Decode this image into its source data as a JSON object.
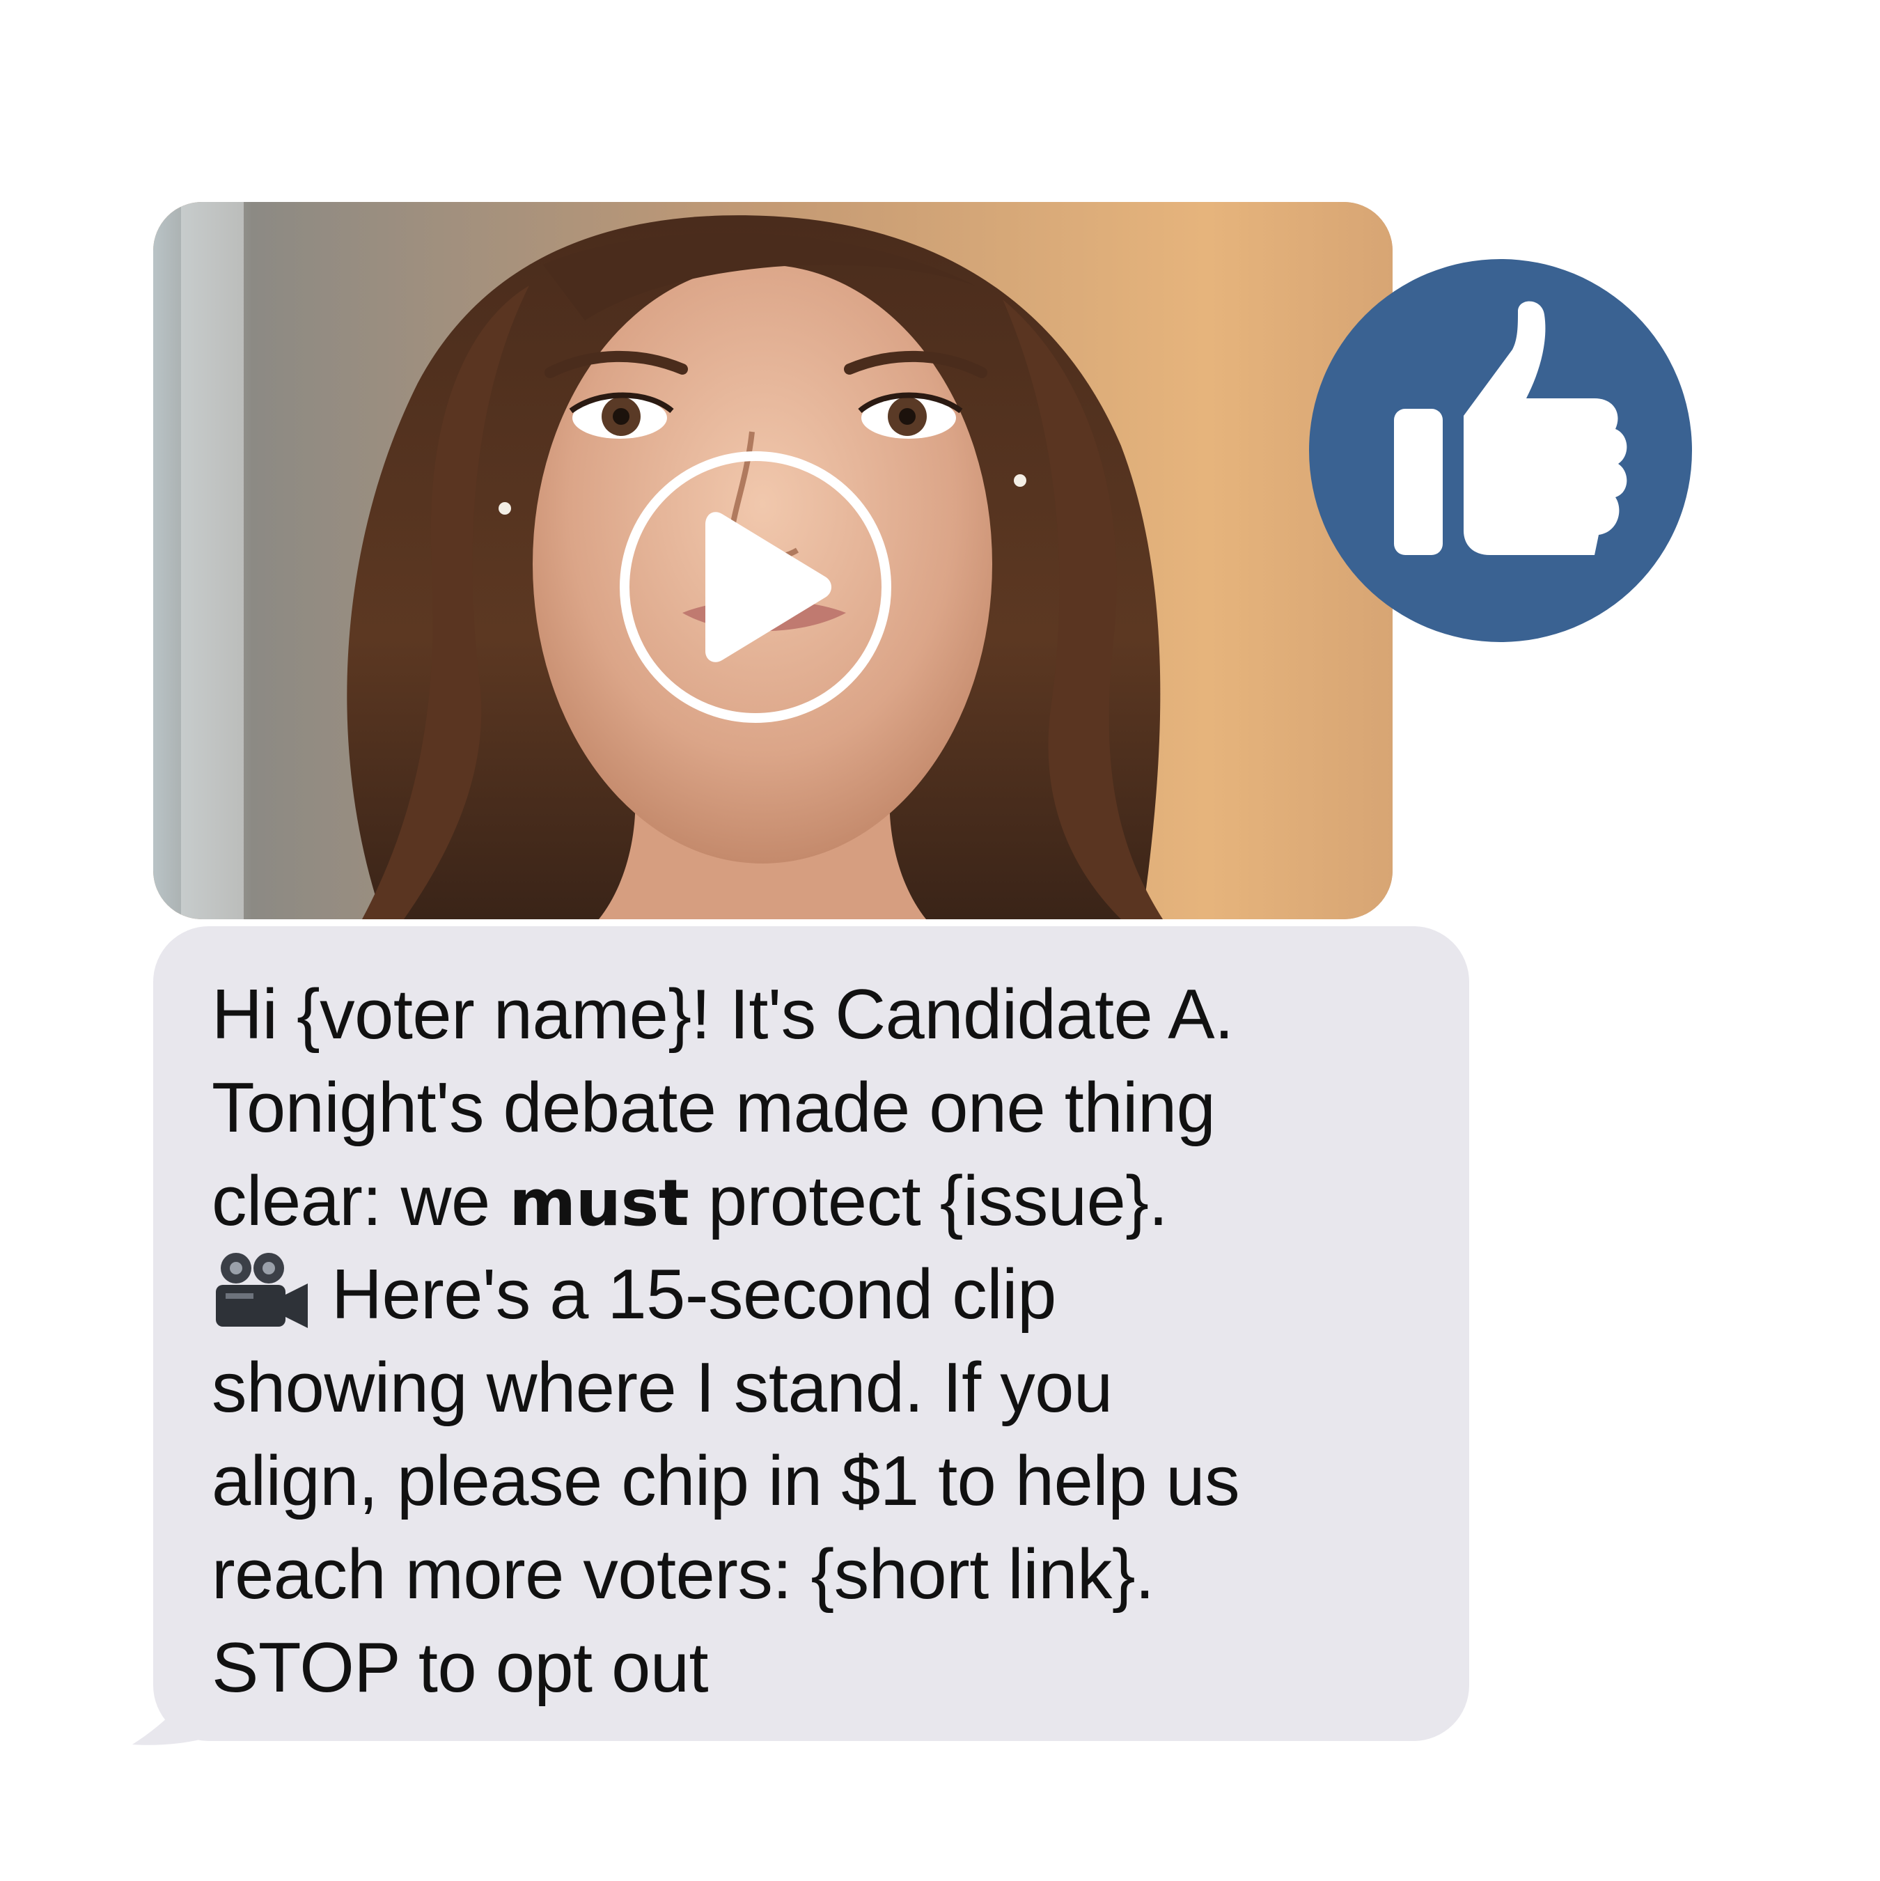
{
  "video": {
    "play_icon": "play-icon",
    "thumbnail": "woman-portrait"
  },
  "reaction": {
    "icon": "thumbs-up-icon",
    "color": "#3a6292"
  },
  "message": {
    "line1": "Hi {voter name}! It's Candidate A.",
    "line2": "Tonight's debate made one thing",
    "line3_before": "clear: we ",
    "line3_bold": "must",
    "line3_after": " protect {issue}.",
    "line4_icon": "movie-camera-icon",
    "line4_text": "Here's a 15-second clip",
    "line5": "showing where I stand. If you",
    "line6": "align, please chip in $1 to help us",
    "line7": "reach more voters: {short link}.",
    "line8": "STOP to opt out",
    "bubble_color": "#e8e7ed"
  }
}
